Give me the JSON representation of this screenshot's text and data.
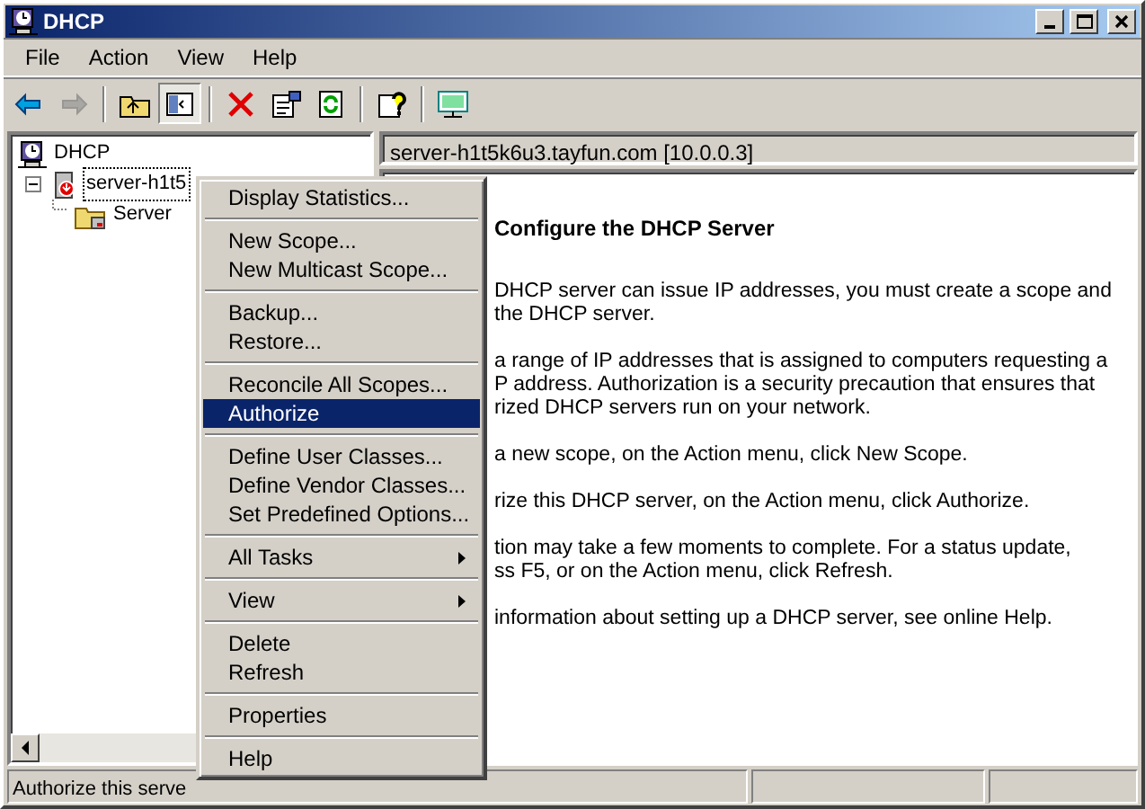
{
  "window": {
    "title": "DHCP"
  },
  "menu_bar": [
    "File",
    "Action",
    "View",
    "Help"
  ],
  "toolbar": [
    {
      "kind": "back"
    },
    {
      "kind": "forward",
      "disabled": true
    },
    {
      "kind": "separator"
    },
    {
      "kind": "up"
    },
    {
      "kind": "tree",
      "pressed": true
    },
    {
      "kind": "separator"
    },
    {
      "kind": "delete"
    },
    {
      "kind": "properties"
    },
    {
      "kind": "refresh"
    },
    {
      "kind": "separator"
    },
    {
      "kind": "help"
    },
    {
      "kind": "separator"
    },
    {
      "kind": "monitor"
    }
  ],
  "tree": [
    {
      "label": "DHCP",
      "kind": "root",
      "children": [
        {
          "label": "server-h1t5",
          "kind": "server",
          "expanded": true,
          "children": [
            {
              "label": "Server",
              "kind": "folder"
            }
          ]
        }
      ]
    }
  ],
  "details": {
    "header": "server-h1t5k6u3.tayfun.com [10.0.0.3]",
    "heading": "Configure the DHCP Server",
    "paragraphs": [
      [
        "DHCP server can issue IP addresses, you must create a scope and",
        "the DHCP server."
      ],
      [
        "a range of IP addresses that is assigned to computers requesting a",
        "P address. Authorization is a security precaution that ensures that",
        "rized DHCP servers run on your network."
      ],
      [
        "a new scope, on the Action menu, click New Scope."
      ],
      [
        "rize this DHCP server, on the Action menu, click Authorize."
      ],
      [
        "tion may take a few moments to complete. For a status update,",
        "ss F5, or on the Action menu, click Refresh."
      ],
      [
        "information about setting up a DHCP server, see online Help."
      ]
    ]
  },
  "context_menu": [
    {
      "kind": "item",
      "label": "Display Statistics...",
      "selected": false
    },
    {
      "kind": "separator"
    },
    {
      "kind": "item",
      "label": "New Scope...",
      "selected": false
    },
    {
      "kind": "item",
      "label": "New Multicast Scope...",
      "selected": false
    },
    {
      "kind": "separator"
    },
    {
      "kind": "item",
      "label": "Backup...",
      "selected": false
    },
    {
      "kind": "item",
      "label": "Restore...",
      "selected": false
    },
    {
      "kind": "separator"
    },
    {
      "kind": "item",
      "label": "Reconcile All Scopes...",
      "selected": false
    },
    {
      "kind": "item",
      "label": "Authorize",
      "selected": true
    },
    {
      "kind": "separator"
    },
    {
      "kind": "item",
      "label": "Define User Classes...",
      "selected": false
    },
    {
      "kind": "item",
      "label": "Define Vendor Classes...",
      "selected": false
    },
    {
      "kind": "item",
      "label": "Set Predefined Options...",
      "selected": false
    },
    {
      "kind": "separator"
    },
    {
      "kind": "submenu",
      "label": "All Tasks",
      "selected": false
    },
    {
      "kind": "separator"
    },
    {
      "kind": "submenu",
      "label": "View",
      "selected": false
    },
    {
      "kind": "separator"
    },
    {
      "kind": "item",
      "label": "Delete",
      "selected": false
    },
    {
      "kind": "item",
      "label": "Refresh",
      "selected": false
    },
    {
      "kind": "separator"
    },
    {
      "kind": "item",
      "label": "Properties",
      "selected": false
    },
    {
      "kind": "separator"
    },
    {
      "kind": "item",
      "label": "Help",
      "selected": false
    }
  ],
  "status_bar": {
    "text": "Authorize this serve"
  }
}
